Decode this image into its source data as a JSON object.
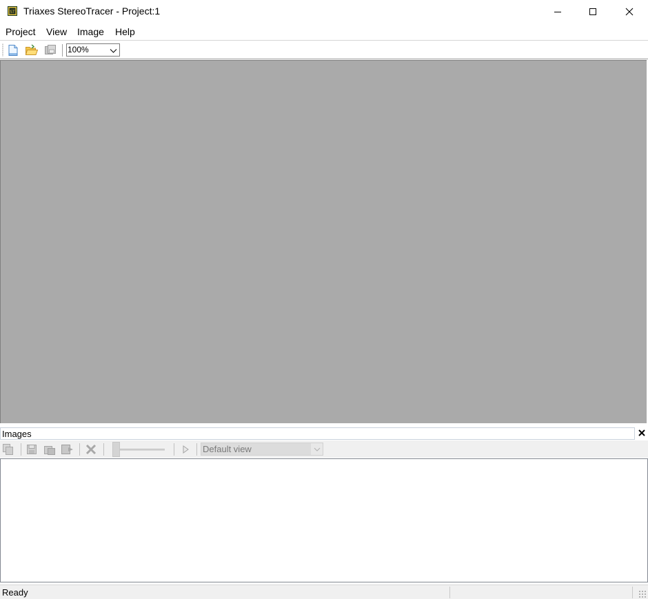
{
  "window": {
    "title": "Triaxes StereoTracer - Project:1",
    "app_icon": "stereotracer-app-icon",
    "controls": [
      "minimize-icon",
      "maximize-icon",
      "close-icon"
    ]
  },
  "menu": {
    "items": [
      {
        "label": "Project"
      },
      {
        "label": "View"
      },
      {
        "label": "Image"
      },
      {
        "label": "Help"
      }
    ]
  },
  "toolbar": {
    "buttons": [
      "new-document-icon",
      "open-folder-icon",
      "save-disk-icon"
    ],
    "zoom": {
      "value": "100%"
    }
  },
  "workspace": {
    "background": "#aaaaaa"
  },
  "images_panel": {
    "title": "Images",
    "toolbar_icons": [
      "copy-icon",
      "save-icon",
      "duplicate-icon",
      "export-icon",
      "delete-icon",
      "slider",
      "play-icon"
    ],
    "view_select": {
      "value": "Default view",
      "enabled": false
    }
  },
  "statusbar": {
    "text": "Ready"
  },
  "colors": {
    "workspace_gray": "#aaaaaa",
    "status_bg": "#f0f0f0"
  }
}
